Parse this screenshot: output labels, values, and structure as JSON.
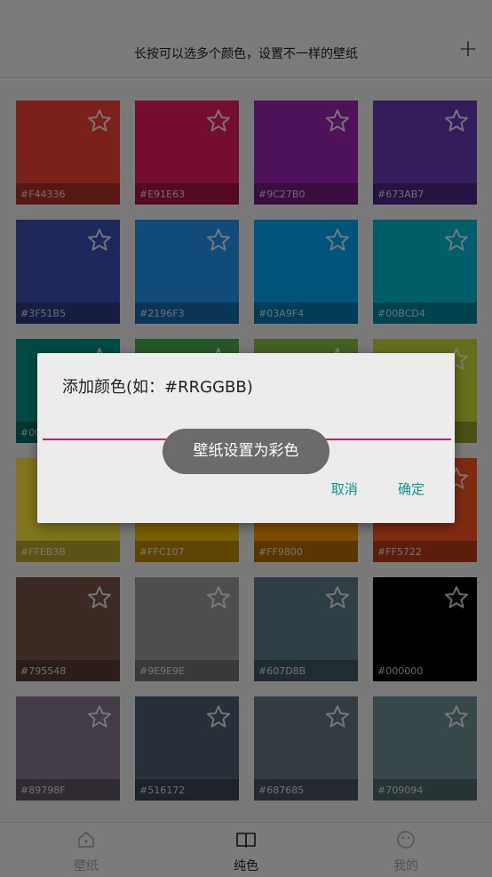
{
  "header": {
    "hint": "长按可以选多个颜色，设置不一样的壁纸",
    "add_symbol": "+"
  },
  "swatches": [
    {
      "code": "#F44336",
      "color": "#F44336"
    },
    {
      "code": "#E91E63",
      "color": "#E91E63"
    },
    {
      "code": "#9C27B0",
      "color": "#9C27B0"
    },
    {
      "code": "#673AB7",
      "color": "#673AB7"
    },
    {
      "code": "#3F51B5",
      "color": "#3F51B5"
    },
    {
      "code": "#2196F3",
      "color": "#2196F3"
    },
    {
      "code": "#03A9F4",
      "color": "#03A9F4"
    },
    {
      "code": "#00BCD4",
      "color": "#00BCD4"
    },
    {
      "code": "#00",
      "color": "#009688"
    },
    {
      "code": "",
      "color": "#4CAF50"
    },
    {
      "code": "",
      "color": "#8BC34A"
    },
    {
      "code": "",
      "color": "#CDDC39"
    },
    {
      "code": "#FFEB3B",
      "color": "#FFEB3B"
    },
    {
      "code": "#FFC107",
      "color": "#FFC107"
    },
    {
      "code": "#FF9800",
      "color": "#FF9800"
    },
    {
      "code": "#FF5722",
      "color": "#FF5722"
    },
    {
      "code": "#795548",
      "color": "#795548"
    },
    {
      "code": "#9E9E9E",
      "color": "#9E9E9E"
    },
    {
      "code": "#607D8B",
      "color": "#607D8B"
    },
    {
      "code": "#000000",
      "color": "#000000"
    },
    {
      "code": "#89798F",
      "color": "#89798F"
    },
    {
      "code": "#516172",
      "color": "#516172"
    },
    {
      "code": "#687685",
      "color": "#687685"
    },
    {
      "code": "#709094",
      "color": "#709094"
    }
  ],
  "dialog": {
    "title": "添加颜色(如：#RRGGBB)",
    "input_value": "",
    "cancel_label": "取消",
    "confirm_label": "确定",
    "underline_color": "#D81B60",
    "button_color": "#12948A"
  },
  "toast": {
    "text": "壁纸设置为彩色"
  },
  "bottom_nav": {
    "items": [
      {
        "label": "壁纸",
        "icon": "house-icon",
        "active": false
      },
      {
        "label": "纯色",
        "icon": "book-icon",
        "active": true
      },
      {
        "label": "我的",
        "icon": "smiley-icon",
        "active": false
      }
    ]
  }
}
